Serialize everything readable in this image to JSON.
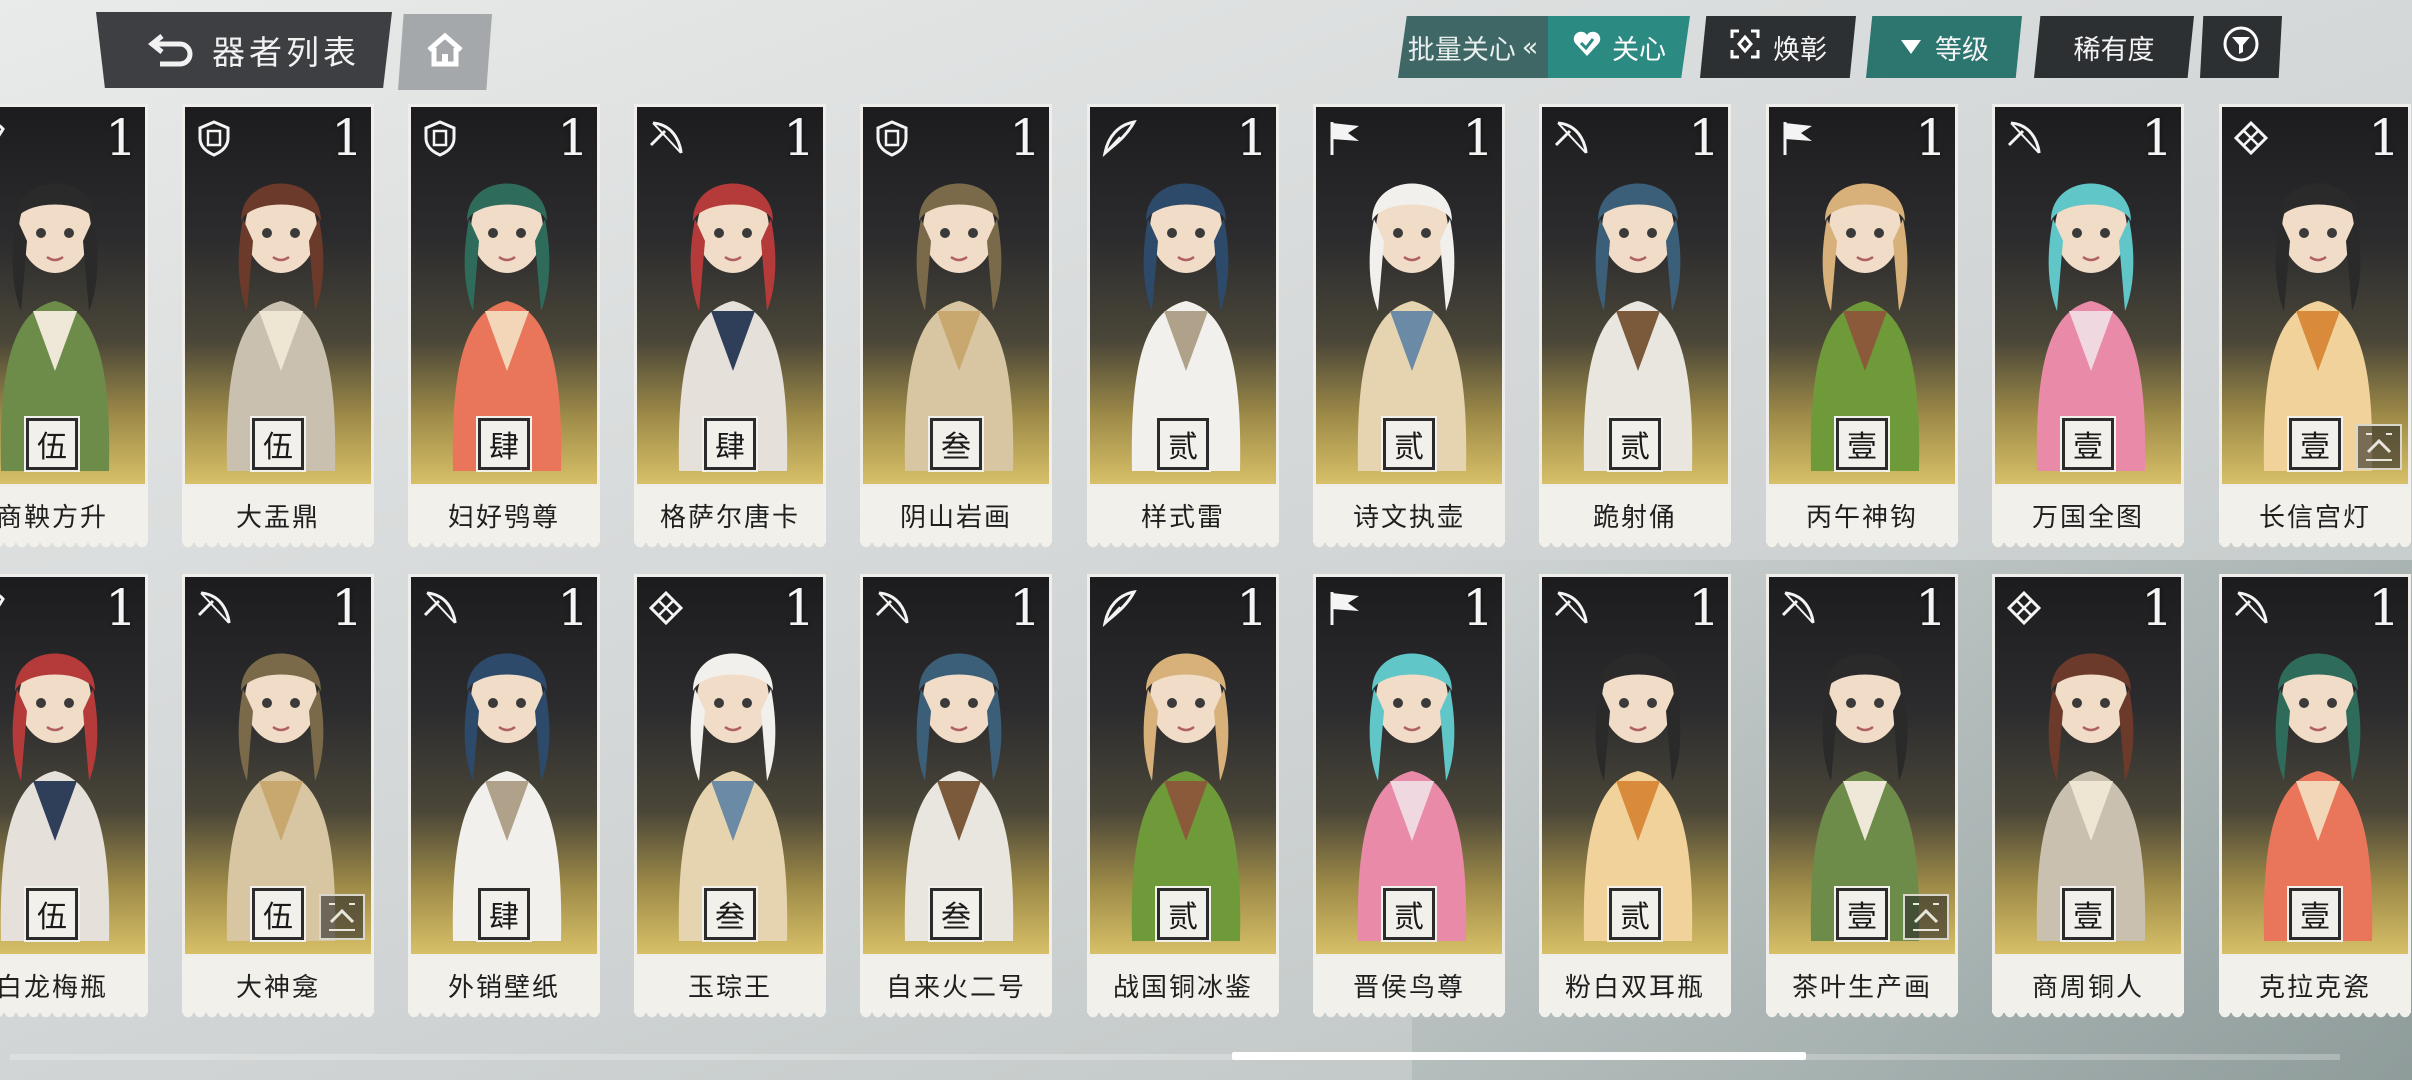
{
  "header": {
    "title": "器者列表"
  },
  "toolbar": {
    "batch_label": "批量关心",
    "batch_chevron": "«",
    "care_label": "关心",
    "glow_label": "焕彰",
    "level_label": "等级",
    "rarity_label": "稀有度"
  },
  "colors": {
    "teal": "#2b8a82",
    "dark": "#2d3033",
    "plate": "#f2f0ea"
  },
  "rows": [
    {
      "cards": [
        {
          "name": "商鞅方升",
          "level": "1",
          "rank": "伍",
          "class_icon": "fan-icon",
          "upgrade": false
        },
        {
          "name": "大盂鼎",
          "level": "1",
          "rank": "伍",
          "class_icon": "shield-icon",
          "upgrade": false
        },
        {
          "name": "妇好鸮尊",
          "level": "1",
          "rank": "肆",
          "class_icon": "shield-icon",
          "upgrade": false
        },
        {
          "name": "格萨尔唐卡",
          "level": "1",
          "rank": "肆",
          "class_icon": "bow-icon",
          "upgrade": false
        },
        {
          "name": "阴山岩画",
          "level": "1",
          "rank": "叁",
          "class_icon": "shield-icon",
          "upgrade": false
        },
        {
          "name": "样式雷",
          "level": "1",
          "rank": "贰",
          "class_icon": "quill-icon",
          "upgrade": false
        },
        {
          "name": "诗文执壶",
          "level": "1",
          "rank": "贰",
          "class_icon": "flag-icon",
          "upgrade": false
        },
        {
          "name": "跪射俑",
          "level": "1",
          "rank": "贰",
          "class_icon": "bow-icon",
          "upgrade": false
        },
        {
          "name": "丙午神钩",
          "level": "1",
          "rank": "壹",
          "class_icon": "flag-icon",
          "upgrade": false
        },
        {
          "name": "万国全图",
          "level": "1",
          "rank": "壹",
          "class_icon": "bow-icon",
          "upgrade": false
        },
        {
          "name": "长信宫灯",
          "level": "1",
          "rank": "壹",
          "class_icon": "knot-icon",
          "upgrade": true
        }
      ]
    },
    {
      "cards": [
        {
          "name": "白龙梅瓶",
          "level": "1",
          "rank": "伍",
          "class_icon": "fan-icon",
          "upgrade": false
        },
        {
          "name": "大神龛",
          "level": "1",
          "rank": "伍",
          "class_icon": "bow-icon",
          "upgrade": true
        },
        {
          "name": "外销壁纸",
          "level": "1",
          "rank": "肆",
          "class_icon": "bow-icon",
          "upgrade": false
        },
        {
          "name": "玉琮王",
          "level": "1",
          "rank": "叁",
          "class_icon": "knot-icon",
          "upgrade": false
        },
        {
          "name": "自来火二号",
          "level": "1",
          "rank": "叁",
          "class_icon": "bow-icon",
          "upgrade": false
        },
        {
          "name": "战国铜冰鉴",
          "level": "1",
          "rank": "贰",
          "class_icon": "quill-icon",
          "upgrade": false
        },
        {
          "name": "晋侯鸟尊",
          "level": "1",
          "rank": "贰",
          "class_icon": "flag-icon",
          "upgrade": false
        },
        {
          "name": "粉白双耳瓶",
          "level": "1",
          "rank": "贰",
          "class_icon": "bow-icon",
          "upgrade": false
        },
        {
          "name": "茶叶生产画",
          "level": "1",
          "rank": "壹",
          "class_icon": "bow-icon",
          "upgrade": true
        },
        {
          "name": "商周铜人",
          "level": "1",
          "rank": "壹",
          "class_icon": "knot-icon",
          "upgrade": false
        },
        {
          "name": "克拉克瓷",
          "level": "1",
          "rank": "壹",
          "class_icon": "bow-icon",
          "upgrade": false
        }
      ]
    }
  ]
}
